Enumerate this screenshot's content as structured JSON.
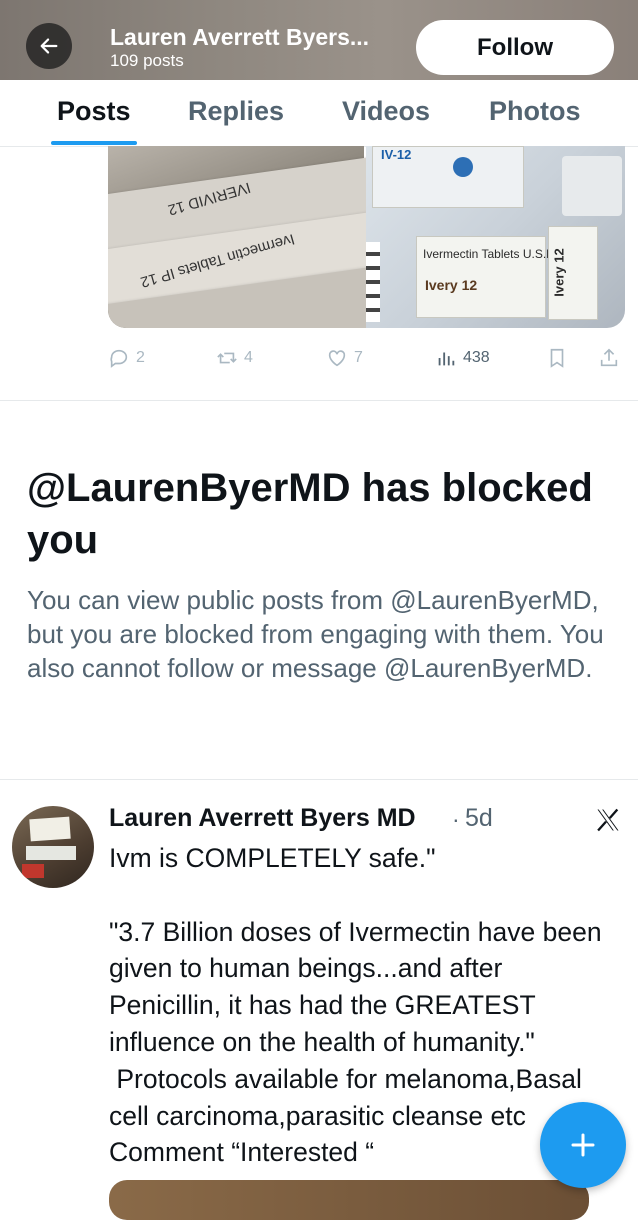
{
  "header": {
    "name": "Lauren Averrett Byers...",
    "post_count": "109 posts",
    "follow_label": "Follow",
    "background_color": "#8a847d"
  },
  "tabs": [
    {
      "label": "Posts",
      "active": true
    },
    {
      "label": "Replies",
      "active": false
    },
    {
      "label": "Videos",
      "active": false
    },
    {
      "label": "Photos",
      "active": false
    }
  ],
  "media_left": {
    "strip_texts": [
      "Ivermectin Tablets IP 12",
      "IVERIVID 12"
    ]
  },
  "media_right": {
    "labels": [
      "IV-12",
      "Ivermectin Tablets U.S.P.",
      "Ivery 12",
      "Ivery 12"
    ]
  },
  "actions": {
    "replies": "2",
    "reposts": "4",
    "likes": "7",
    "views": "438"
  },
  "block_notice": {
    "title": "@LaurenByerMD has blocked you",
    "body": "You can view public posts from @LaurenByerMD, but you are blocked from engaging with them. You also cannot follow or message @LaurenByerMD."
  },
  "post": {
    "author": "Lauren Averrett Byers MD",
    "separator": "·",
    "time": "5d",
    "text": "Ivm is COMPLETELY safe.\"\n\n\"3.7 Billion doses of Ivermectin have been given to human beings...and after Penicillin, it has had the GREATEST influence on the health of humanity.\"\n Protocols available for melanoma,Basal cell carcinoma,parasitic cleanse etc\nComment “Interested “"
  },
  "colors": {
    "accent": "#1d9bf0",
    "text_primary": "#0f1419",
    "text_secondary": "#536471"
  },
  "icons": [
    "back-arrow-icon",
    "reply-icon",
    "repost-icon",
    "like-icon",
    "views-icon",
    "bookmark-icon",
    "share-icon",
    "x-logo-icon",
    "plus-icon"
  ]
}
